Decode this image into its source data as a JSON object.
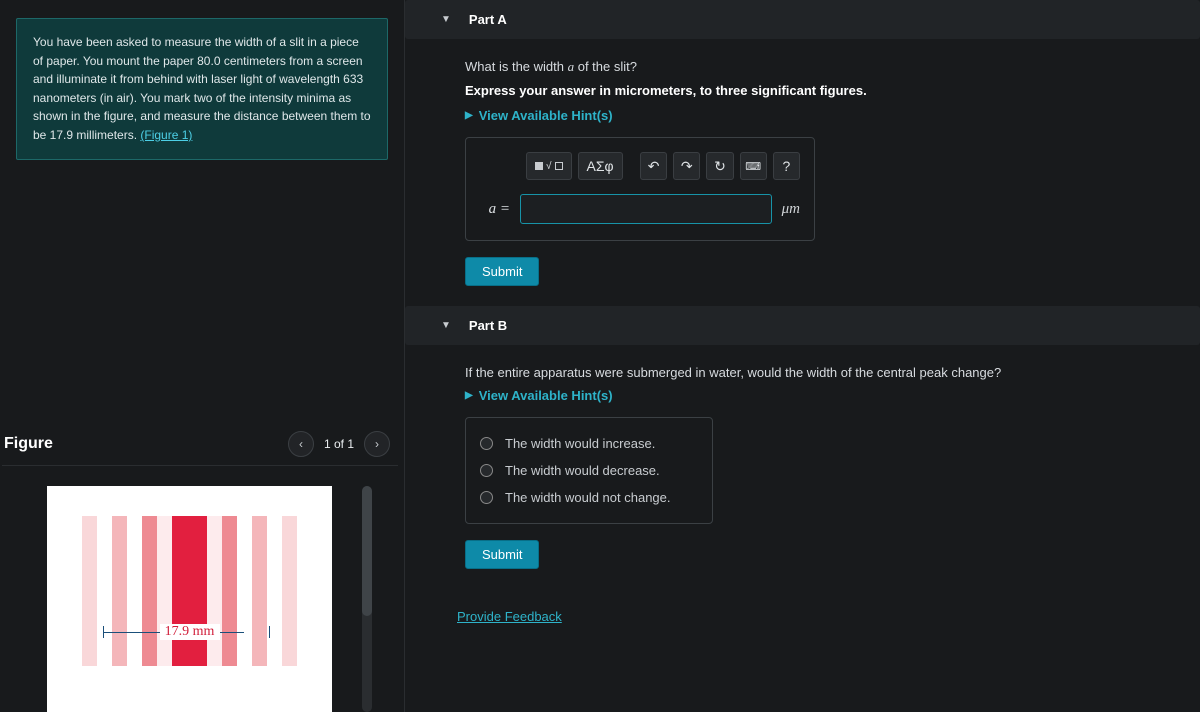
{
  "problem": {
    "text_before_link": "You have been asked to measure the width of a slit in a piece of paper. You mount the paper 80.0 centimeters from a screen and illuminate it from behind with laser light of wavelength 633 nanometers (in air). You mark two of the intensity minima as shown in the figure, and measure the distance between them to be 17.9 millimeters. ",
    "link_text": "(Figure 1)"
  },
  "figure": {
    "title": "Figure",
    "count": "1 of 1",
    "dimension_label": "17.9 mm"
  },
  "partA": {
    "title": "Part A",
    "question_prefix": "What is the width ",
    "question_var": "a",
    "question_suffix": " of the slit?",
    "instruction": "Express your answer in micrometers, to three significant figures.",
    "hints": "View Available Hint(s)",
    "toolbar": {
      "greek": "ΑΣφ"
    },
    "var_label": "a =",
    "unit": "μm",
    "submit": "Submit"
  },
  "partB": {
    "title": "Part B",
    "question": "If the entire apparatus were submerged in water, would the width of the central peak change?",
    "hints": "View Available Hint(s)",
    "options": [
      "The width would increase.",
      "The width would decrease.",
      "The width would not change."
    ],
    "submit": "Submit"
  },
  "feedback": "Provide Feedback"
}
